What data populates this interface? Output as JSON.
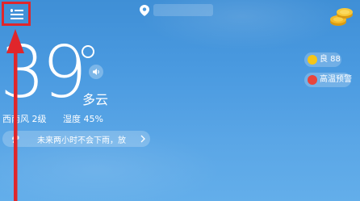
{
  "header": {
    "menu_icon": "menu-icon",
    "location_icon": "location-pin-icon",
    "coins_icon": "gold-coins-icon"
  },
  "current": {
    "temperature": "39",
    "condition": "多云",
    "wind": "西南风 2级",
    "humidity": "湿度 45%"
  },
  "forecast": {
    "text": "未来两小时不会下雨，放",
    "icon": "rain-icon"
  },
  "badges": {
    "aqi": {
      "label": "良 88",
      "color": "#f5c518"
    },
    "alert": {
      "label": "高温预警",
      "color": "#e8453c"
    }
  },
  "annotation": {
    "highlight_color": "#e0262b",
    "arrow_color": "#e0262b"
  }
}
